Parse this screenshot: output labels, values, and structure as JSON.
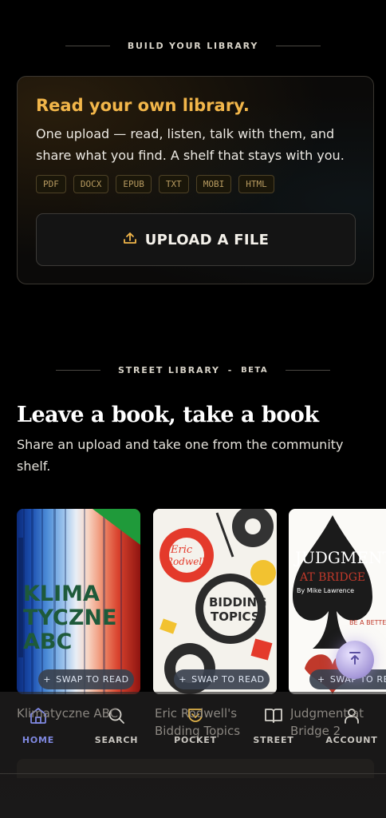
{
  "library_section": {
    "heading": "BUILD YOUR LIBRARY"
  },
  "upload_card": {
    "title": "Read your own library.",
    "description": "One upload — read, listen, talk with them, and share what you find. A shelf that stays with you.",
    "formats": [
      "PDF",
      "DOCX",
      "EPUB",
      "TXT",
      "MOBI",
      "HTML"
    ],
    "upload_button": "UPLOAD A FILE"
  },
  "street_section": {
    "heading": "STREET LIBRARY",
    "separator": "-",
    "badge": "BETA",
    "title": "Leave a book, take a book",
    "subtitle": "Share an upload and take one from the community shelf."
  },
  "books": [
    {
      "title": "Klimatyczne ABC",
      "cover_text": [
        "KLIMA",
        "TYCZNE",
        "ABC"
      ],
      "swap_label": "SWAP TO READ"
    },
    {
      "title": "Eric Rodwell's Bidding Topics",
      "cover_text": [
        "Eric",
        "Rodwell's",
        "BIDDING",
        "TOPICS"
      ],
      "swap_label": "SWAP TO READ"
    },
    {
      "title": "Judgment at Bridge 2",
      "cover_text": [
        "JUDGMENT",
        "AT BRIDGE",
        "By Mike Lawrence",
        "BE A BETTER PLAYER & MORE"
      ],
      "swap_label": "SWAP TO READ"
    }
  ],
  "nav": {
    "items": [
      {
        "label": "HOME",
        "icon": "home-icon"
      },
      {
        "label": "SEARCH",
        "icon": "search-icon"
      },
      {
        "label": "POCKET",
        "icon": "pocket-icon"
      },
      {
        "label": "STREET",
        "icon": "book-icon"
      },
      {
        "label": "ACCOUNT",
        "icon": "user-icon"
      }
    ]
  },
  "colors": {
    "accent": "#f2b64a",
    "active_nav": "#7f88e0",
    "background": "#000000"
  }
}
